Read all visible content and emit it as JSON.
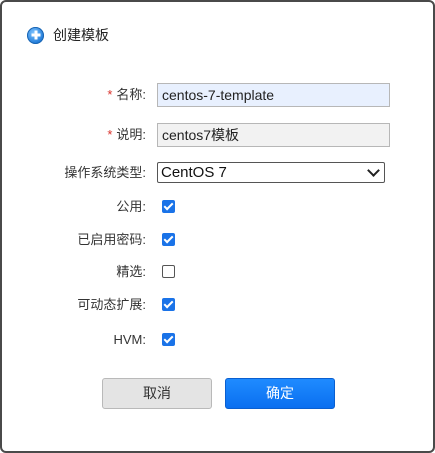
{
  "dialog": {
    "title": "创建模板",
    "fields": {
      "name": {
        "required_mark": "*",
        "label": "名称:",
        "value": "centos-7-template"
      },
      "description": {
        "required_mark": "*",
        "label": "说明:",
        "value": "centos7模板"
      },
      "os_type": {
        "label": "操作系统类型:",
        "selected": "CentOS 7"
      },
      "public": {
        "label": "公用:",
        "checked": true
      },
      "password_enabled": {
        "label": "已启用密码:",
        "checked": true
      },
      "featured": {
        "label": "精选:",
        "checked": false
      },
      "dynamically_scalable": {
        "label": "可动态扩展:",
        "checked": true
      },
      "hvm": {
        "label": "HVM:",
        "checked": true
      }
    },
    "buttons": {
      "cancel": "取消",
      "ok": "确定"
    }
  },
  "colors": {
    "primary": "#1a73e8",
    "required": "#d9302a",
    "name_field_bg": "#e8f0fe"
  }
}
